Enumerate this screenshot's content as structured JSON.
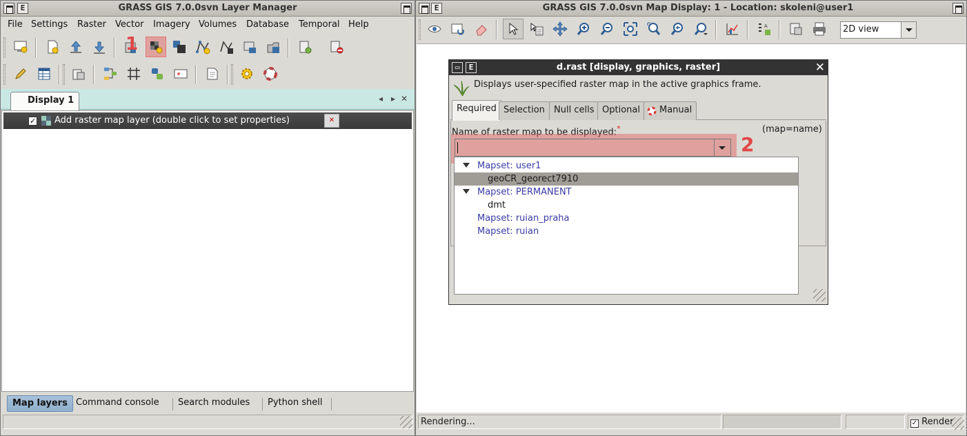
{
  "layer_manager": {
    "title": "GRASS GIS 7.0.0svn Layer Manager",
    "menu": [
      "File",
      "Settings",
      "Raster",
      "Vector",
      "Imagery",
      "Volumes",
      "Database",
      "Temporal",
      "Help"
    ],
    "display_tab": "Display 1",
    "layer": {
      "checked": true,
      "label": "Add raster map layer (double click to set properties)"
    },
    "bottom_tabs": [
      "Map layers",
      "Command console",
      "Search modules",
      "Python shell"
    ],
    "active_bottom_tab": "Map layers",
    "highlight_marker": "1"
  },
  "map_display": {
    "title": "GRASS GIS 7.0.0svn Map Display: 1  - Location: skoleni@user1",
    "view_mode": "2D view",
    "status_text": "Rendering...",
    "render_checked": true,
    "render_label": "Render"
  },
  "dialog": {
    "title": "d.rast [display, graphics, raster]",
    "description": "Displays user-specified raster map in the active graphics frame.",
    "tabs": [
      "Required",
      "Selection",
      "Null cells",
      "Optional",
      "Manual"
    ],
    "active_tab": "Required",
    "param_label": "Name of raster map to be displayed:",
    "required_mark": "*",
    "param_key": "(map=name)",
    "input_value": "",
    "highlight_marker": "2",
    "mapset_list": [
      {
        "type": "mapset",
        "label": "Mapset: user1",
        "expanded": true
      },
      {
        "type": "map",
        "label": "geoCR_georect7910",
        "selected": true
      },
      {
        "type": "mapset",
        "label": "Mapset: PERMANENT",
        "expanded": true
      },
      {
        "type": "map",
        "label": "dmt",
        "selected": false
      },
      {
        "type": "mapset",
        "label": "Mapset: ruian_praha",
        "expanded": false
      },
      {
        "type": "mapset",
        "label": "Mapset: ruian",
        "expanded": false
      }
    ]
  },
  "colors": {
    "highlight": "#e25a5a",
    "dialog_titlebar": "#333333",
    "mapset_text": "#3a3aa8",
    "notebook_bg": "#c9e7e3",
    "layer_row": "#444444"
  }
}
